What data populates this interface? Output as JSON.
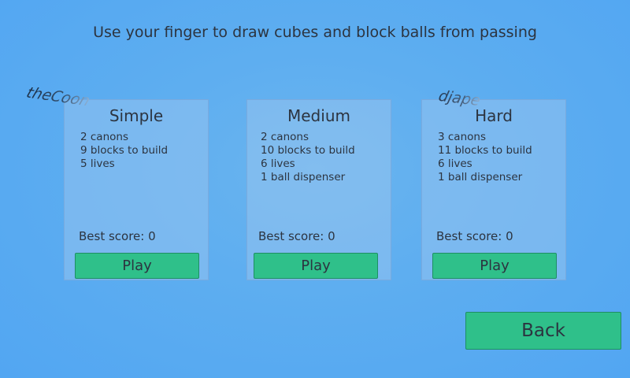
{
  "instructions": "Use your finger to draw cubes and block balls from passing",
  "levels": [
    {
      "title": "Simple",
      "lines": [
        "2 canons",
        "9 blocks to build",
        "5 lives",
        ""
      ],
      "best_score": "Best score: 0",
      "play_label": "Play"
    },
    {
      "title": "Medium",
      "lines": [
        "2 canons",
        "10 blocks to build",
        "6 lives",
        "1 ball dispenser"
      ],
      "best_score": "Best score: 0",
      "play_label": "Play"
    },
    {
      "title": "Hard",
      "lines": [
        "3 canons",
        "11 blocks to build",
        "6 lives",
        "1 ball dispenser"
      ],
      "best_score": "Best score: 0",
      "play_label": "Play"
    }
  ],
  "authors": [
    "theCoon",
    "djape"
  ],
  "back_label": "Back",
  "colors": {
    "background": "#5eaef0",
    "button": "#2fc08a",
    "text": "#2c3440"
  }
}
